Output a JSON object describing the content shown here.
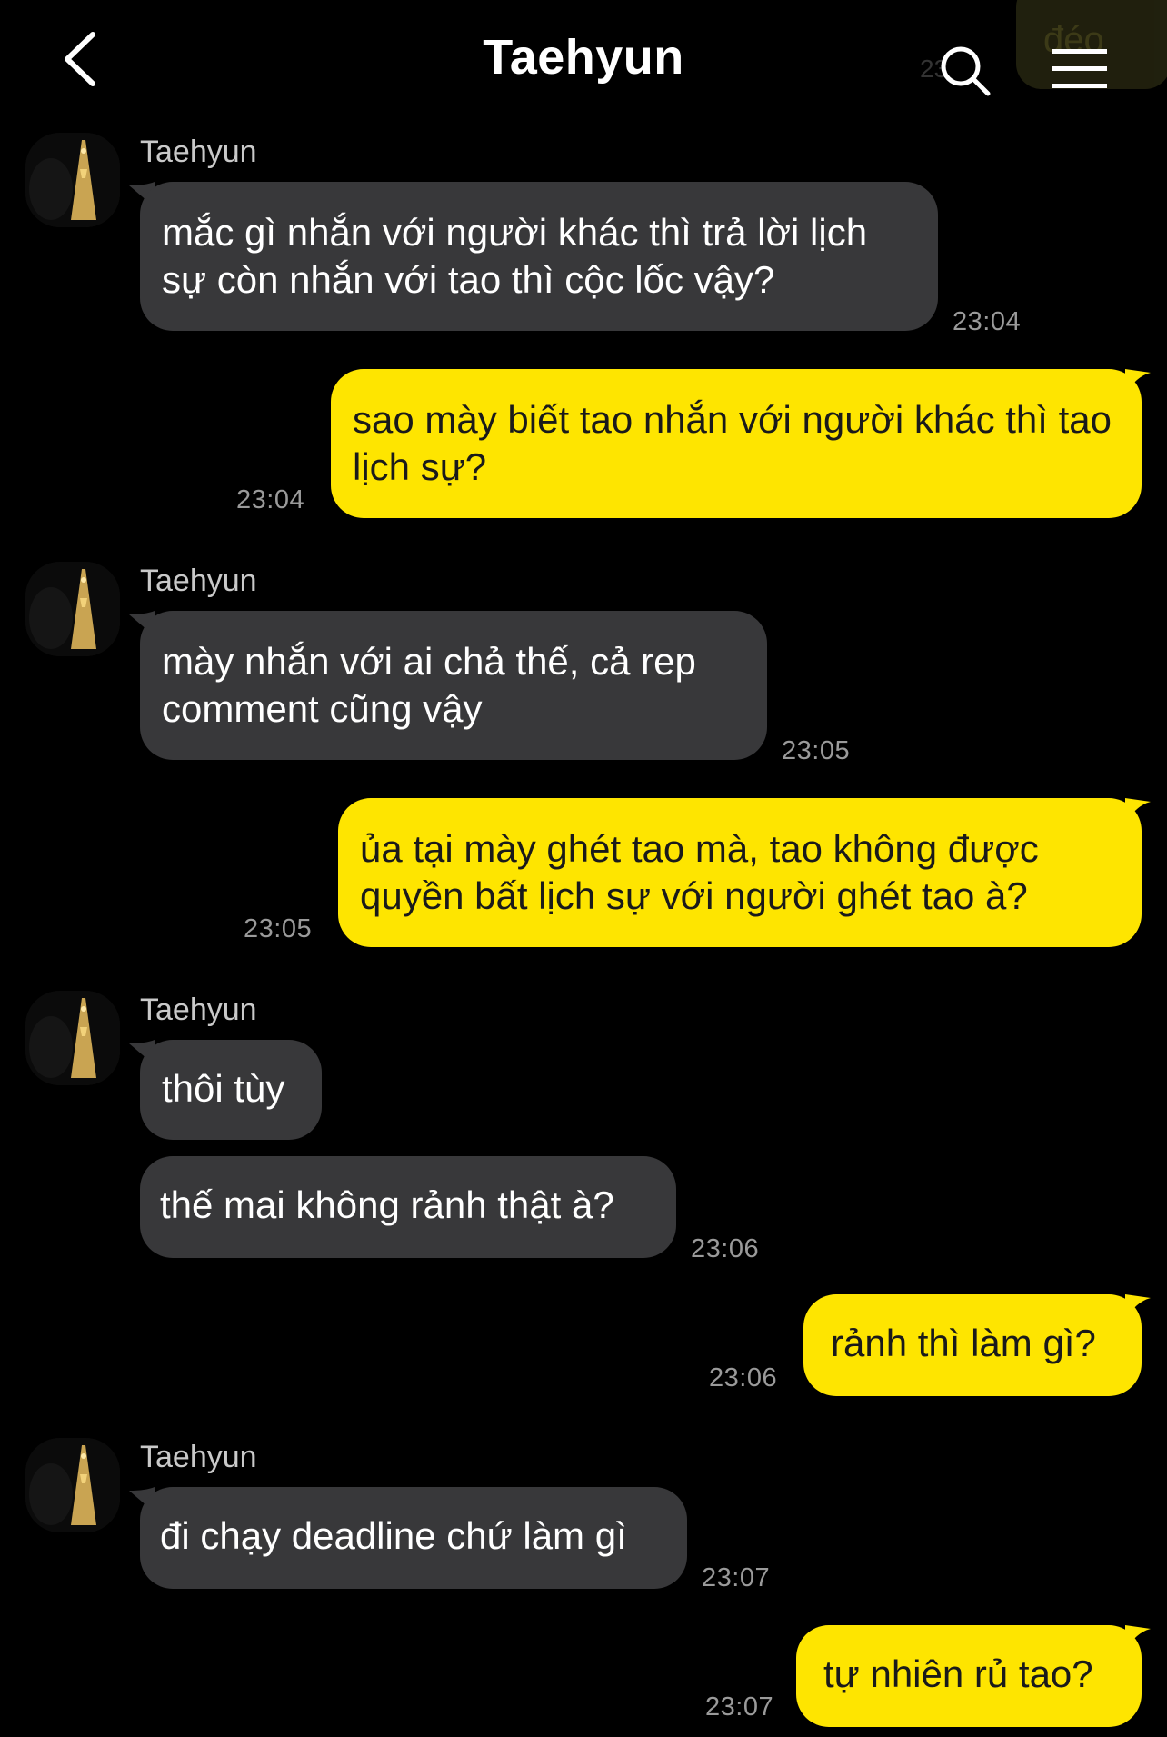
{
  "header": {
    "title": "Taehyun",
    "peek_text": "đéo",
    "peek_time": "23"
  },
  "colors": {
    "background": "#000000",
    "incoming_bubble": "#38383a",
    "outgoing_bubble": "#fee500",
    "timestamp": "#9a9a9a"
  },
  "icons": {
    "back": "chevron-left-icon",
    "search": "search-icon",
    "menu": "hamburger-menu-icon"
  },
  "messages": [
    {
      "sender": "Taehyun",
      "text": "mắc gì nhắn với người khác thì trả lời lịch sự còn nhắn với tao thì cộc lốc vậy?",
      "time": "23:04"
    },
    {
      "text": "sao mày biết tao nhắn với người khác thì tao lịch sự?",
      "time": "23:04"
    },
    {
      "sender": "Taehyun",
      "text": "mày nhắn với ai chả thế, cả rep comment cũng vậy",
      "time": "23:05"
    },
    {
      "text": "ủa tại mày ghét tao mà, tao không được quyền bất lịch sự với người ghét tao à?",
      "time": "23:05"
    },
    {
      "sender": "Taehyun",
      "text": "thôi tùy"
    },
    {
      "text": "thế mai không rảnh thật à?",
      "time": "23:06"
    },
    {
      "text": "rảnh thì làm gì?",
      "time": "23:06"
    },
    {
      "sender": "Taehyun",
      "text": "đi chạy deadline chứ làm gì",
      "time": "23:07"
    },
    {
      "text": "tự nhiên rủ tao?",
      "time": "23:07"
    }
  ]
}
